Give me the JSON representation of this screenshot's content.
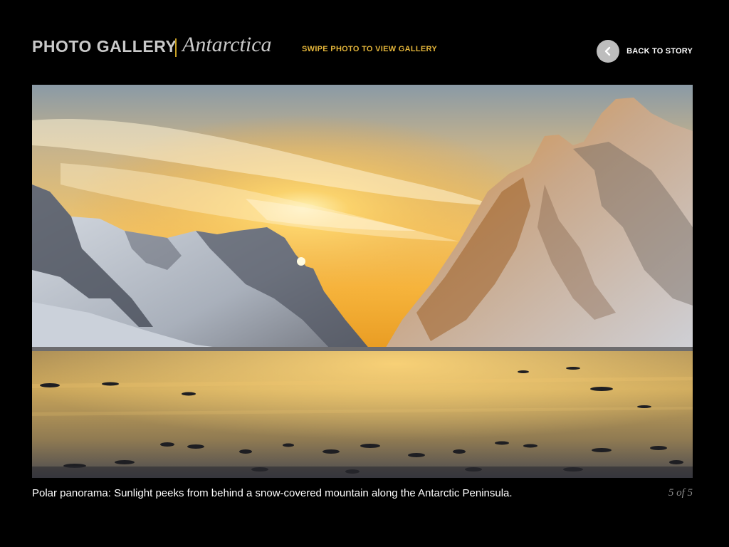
{
  "header": {
    "title": "PHOTO GALLERY",
    "subtitle": "Antarctica",
    "swipe_hint": "SWIPE PHOTO TO VIEW GALLERY",
    "back_button": {
      "label": "BACK TO STORY",
      "icon": "chevron-left-icon"
    }
  },
  "photo": {
    "alt": "Polar panorama: Sunlight peeks from behind a snow-covered mountain along the Antarctic Peninsula."
  },
  "caption": {
    "text": "Polar panorama: Sunlight peeks from behind a snow-covered mountain along the Antarctic Peninsula.",
    "counter": "5 of 5"
  },
  "colors": {
    "background": "#000000",
    "accent": "#e3b53a",
    "title_gray": "#c9c9c9",
    "counter_gray": "#8a8a8a"
  }
}
